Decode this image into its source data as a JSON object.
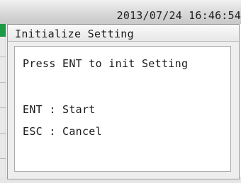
{
  "status_bar": {
    "datetime": "2013/07/24 16:46:54"
  },
  "dialog": {
    "title": "Initialize Setting",
    "message": "Press ENT to init Setting",
    "options": [
      {
        "key_label": "ENT : Start"
      },
      {
        "key_label": "ESC : Cancel"
      }
    ]
  },
  "colors": {
    "accent": "#1e9a46",
    "dialog_bg": "#eeeeee",
    "body_bg": "#ffffff"
  }
}
